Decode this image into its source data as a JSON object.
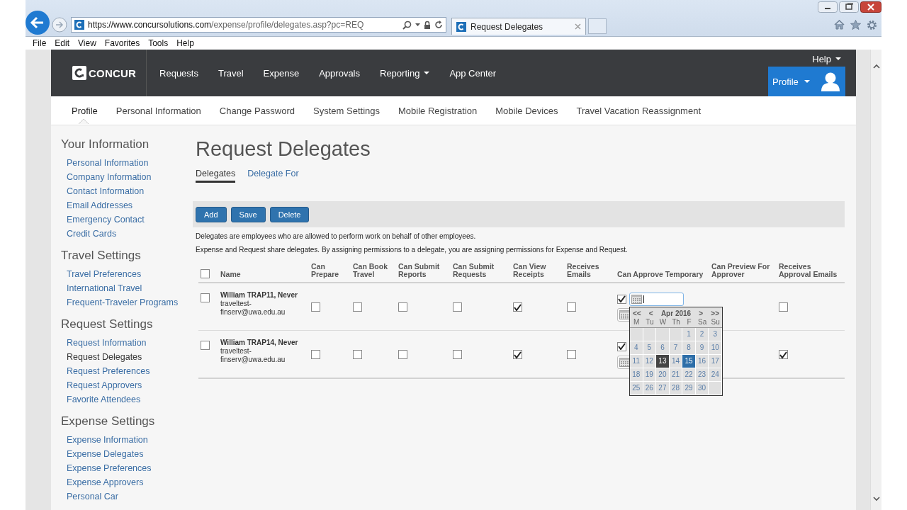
{
  "browser": {
    "url_host": "https://www.concursolutions.com",
    "url_path": "/expense/profile/delegates.asp?pc=REQ",
    "tab_title": "Request Delegates",
    "menu": [
      "File",
      "Edit",
      "View",
      "Favorites",
      "Tools",
      "Help"
    ]
  },
  "header": {
    "logo": "CONCUR",
    "nav": [
      {
        "label": "Requests",
        "dropdown": false
      },
      {
        "label": "Travel",
        "dropdown": false
      },
      {
        "label": "Expense",
        "dropdown": false
      },
      {
        "label": "Approvals",
        "dropdown": false
      },
      {
        "label": "Reporting",
        "dropdown": true
      },
      {
        "label": "App Center",
        "dropdown": false
      }
    ],
    "help": "Help",
    "profile": "Profile"
  },
  "subnav": [
    {
      "label": "Profile",
      "selected": true
    },
    {
      "label": "Personal Information",
      "selected": false
    },
    {
      "label": "Change Password",
      "selected": false
    },
    {
      "label": "System Settings",
      "selected": false
    },
    {
      "label": "Mobile Registration",
      "selected": false
    },
    {
      "label": "Mobile Devices",
      "selected": false
    },
    {
      "label": "Travel Vacation Reassignment",
      "selected": false
    }
  ],
  "sidebar": [
    {
      "heading": "Your Information",
      "items": [
        {
          "label": "Personal Information",
          "selected": false
        },
        {
          "label": "Company Information",
          "selected": false
        },
        {
          "label": "Contact Information",
          "selected": false
        },
        {
          "label": "Email Addresses",
          "selected": false
        },
        {
          "label": "Emergency Contact",
          "selected": false
        },
        {
          "label": "Credit Cards",
          "selected": false
        }
      ]
    },
    {
      "heading": "Travel Settings",
      "items": [
        {
          "label": "Travel Preferences",
          "selected": false
        },
        {
          "label": "International Travel",
          "selected": false
        },
        {
          "label": "Frequent-Traveler Programs",
          "selected": false
        }
      ]
    },
    {
      "heading": "Request Settings",
      "items": [
        {
          "label": "Request Information",
          "selected": false
        },
        {
          "label": "Request Delegates",
          "selected": true
        },
        {
          "label": "Request Preferences",
          "selected": false
        },
        {
          "label": "Request Approvers",
          "selected": false
        },
        {
          "label": "Favorite Attendees",
          "selected": false
        }
      ]
    },
    {
      "heading": "Expense Settings",
      "items": [
        {
          "label": "Expense Information",
          "selected": false
        },
        {
          "label": "Expense Delegates",
          "selected": false
        },
        {
          "label": "Expense Preferences",
          "selected": false
        },
        {
          "label": "Expense Approvers",
          "selected": false
        },
        {
          "label": "Personal Car",
          "selected": false
        }
      ]
    }
  ],
  "main": {
    "title": "Request Delegates",
    "tabs": [
      {
        "label": "Delegates",
        "selected": true
      },
      {
        "label": "Delegate For",
        "selected": false
      }
    ],
    "buttons": [
      "Add",
      "Save",
      "Delete"
    ],
    "notes": [
      "Delegates are employees who are allowed to perform work on behalf of other employees.",
      "Expense and Request share delegates. By assigning permissions to a delegate, you are assigning permissions for Expense and Request."
    ]
  },
  "table": {
    "select_all_checked": false,
    "columns": [
      "Name",
      "Can Prepare",
      "Can Book Travel",
      "Can Submit Reports",
      "Can Submit Requests",
      "Can View Receipts",
      "Receives Emails",
      "Can Approve Temporary",
      "Can Preview For Approver",
      "Receives Approval Emails"
    ],
    "rows": [
      {
        "checked": false,
        "name": "William TRAP11, Never",
        "email": "traveltest-finserv@uwa.edu.au",
        "prepare": false,
        "book_travel": false,
        "submit_reports": false,
        "submit_requests": false,
        "view_receipts": true,
        "receives_emails": false,
        "approve_temporary": true,
        "receives_approval_emails": false
      },
      {
        "checked": false,
        "name": "William TRAP14, Never",
        "email": "traveltest-finserv@uwa.edu.au",
        "prepare": false,
        "book_travel": false,
        "submit_reports": false,
        "submit_requests": false,
        "view_receipts": true,
        "receives_emails": false,
        "approve_temporary": true,
        "receives_approval_emails": true
      }
    ]
  },
  "calendar": {
    "prev_year": "<<",
    "prev_month": "<",
    "month": "Apr 2016",
    "next_month": ">",
    "next_year": ">>",
    "weekdays": [
      "M",
      "Tu",
      "W",
      "Th",
      "F",
      "Sa",
      "Su"
    ],
    "days": [
      {
        "kind": "blank"
      },
      {
        "kind": "blank"
      },
      {
        "kind": "blank"
      },
      {
        "kind": "blank"
      },
      {
        "kind": "day",
        "label": "1",
        "today": false,
        "selected": false
      },
      {
        "kind": "day",
        "label": "2",
        "today": false,
        "selected": false
      },
      {
        "kind": "day",
        "label": "3",
        "today": false,
        "selected": false
      },
      {
        "kind": "day",
        "label": "4",
        "today": false,
        "selected": false
      },
      {
        "kind": "day",
        "label": "5",
        "today": false,
        "selected": false
      },
      {
        "kind": "day",
        "label": "6",
        "today": false,
        "selected": false
      },
      {
        "kind": "day",
        "label": "7",
        "today": false,
        "selected": false
      },
      {
        "kind": "day",
        "label": "8",
        "today": false,
        "selected": false
      },
      {
        "kind": "day",
        "label": "9",
        "today": false,
        "selected": false
      },
      {
        "kind": "day",
        "label": "10",
        "today": false,
        "selected": false
      },
      {
        "kind": "day",
        "label": "11",
        "today": false,
        "selected": false
      },
      {
        "kind": "day",
        "label": "12",
        "today": false,
        "selected": false
      },
      {
        "kind": "day",
        "label": "13",
        "today": true,
        "selected": false
      },
      {
        "kind": "day",
        "label": "14",
        "today": false,
        "selected": false
      },
      {
        "kind": "day",
        "label": "15",
        "today": false,
        "selected": true
      },
      {
        "kind": "day",
        "label": "16",
        "today": false,
        "selected": false
      },
      {
        "kind": "day",
        "label": "17",
        "today": false,
        "selected": false
      },
      {
        "kind": "day",
        "label": "18",
        "today": false,
        "selected": false
      },
      {
        "kind": "day",
        "label": "19",
        "today": false,
        "selected": false
      },
      {
        "kind": "day",
        "label": "20",
        "today": false,
        "selected": false
      },
      {
        "kind": "day",
        "label": "21",
        "today": false,
        "selected": false
      },
      {
        "kind": "day",
        "label": "22",
        "today": false,
        "selected": false
      },
      {
        "kind": "day",
        "label": "23",
        "today": false,
        "selected": false
      },
      {
        "kind": "day",
        "label": "24",
        "today": false,
        "selected": false
      },
      {
        "kind": "day",
        "label": "25",
        "today": false,
        "selected": false
      },
      {
        "kind": "day",
        "label": "26",
        "today": false,
        "selected": false
      },
      {
        "kind": "day",
        "label": "27",
        "today": false,
        "selected": false
      },
      {
        "kind": "day",
        "label": "28",
        "today": false,
        "selected": false
      },
      {
        "kind": "day",
        "label": "29",
        "today": false,
        "selected": false
      },
      {
        "kind": "day",
        "label": "30",
        "today": false,
        "selected": false
      },
      {
        "kind": "blank"
      }
    ]
  }
}
